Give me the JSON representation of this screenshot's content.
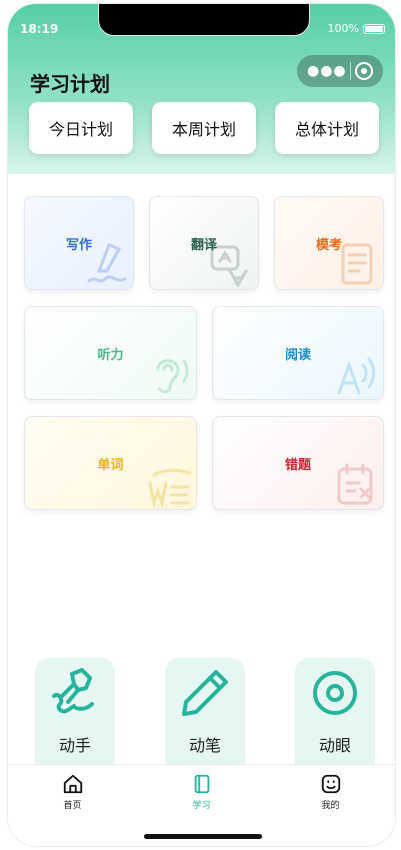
{
  "status_bar": {
    "time": "18:19",
    "battery": "100%"
  },
  "header": {
    "title": "学习计划"
  },
  "plan_tabs": [
    {
      "label": "今日计划"
    },
    {
      "label": "本周计划"
    },
    {
      "label": "总体计划"
    }
  ],
  "cards": [
    {
      "label": "写作",
      "color": "#2f6fd6"
    },
    {
      "label": "翻译",
      "color": "#2b5f4f"
    },
    {
      "label": "模考",
      "color": "#e26e1d"
    },
    {
      "label": "听力",
      "color": "#47b884"
    },
    {
      "label": "阅读",
      "color": "#1b8bd0"
    },
    {
      "label": "单词",
      "color": "#e8b317"
    },
    {
      "label": "错题",
      "color": "#c9262e"
    }
  ],
  "tools": [
    {
      "label": "动手",
      "icon": "hand-icon"
    },
    {
      "label": "动笔",
      "icon": "pencil-icon"
    },
    {
      "label": "动眼",
      "icon": "eye-icon"
    }
  ],
  "tabbar": [
    {
      "label": "首页",
      "icon": "home-icon"
    },
    {
      "label": "学习",
      "icon": "book-icon"
    },
    {
      "label": "我的",
      "icon": "smile-icon"
    }
  ],
  "colors": {
    "accent": "#26b59c",
    "header_gradient_top": "#56cfa6"
  }
}
